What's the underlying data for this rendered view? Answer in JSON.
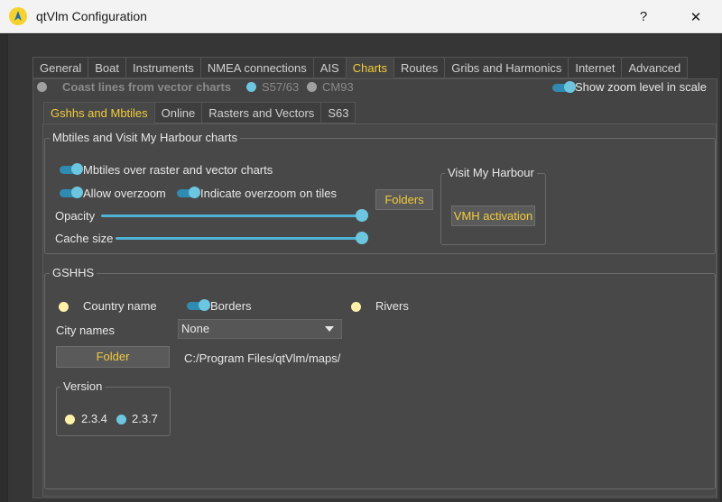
{
  "window": {
    "title": "qtVlm Configuration",
    "help_label": "?",
    "close_label": "✕"
  },
  "main_tabs": [
    {
      "label": "General",
      "active": false
    },
    {
      "label": "Boat",
      "active": false
    },
    {
      "label": "Instruments",
      "active": false
    },
    {
      "label": "NMEA connections",
      "active": false
    },
    {
      "label": "AIS",
      "active": false
    },
    {
      "label": "Charts",
      "active": true
    },
    {
      "label": "Routes",
      "active": false
    },
    {
      "label": "Gribs and Harmonics",
      "active": false
    },
    {
      "label": "Internet",
      "active": false
    },
    {
      "label": "Advanced",
      "active": false
    }
  ],
  "charts_page": {
    "coast_lines_label": "Coast lines from vector charts",
    "s5763_label": "S57/63",
    "cm93_label": "CM93",
    "zoom_level_label": "Show zoom level in scale",
    "sub_tabs": [
      {
        "label": "Gshhs and Mbtiles",
        "active": true
      },
      {
        "label": "Online",
        "active": false
      },
      {
        "label": "Rasters and Vectors",
        "active": false
      },
      {
        "label": "S63",
        "active": false
      }
    ]
  },
  "mbtiles": {
    "group_title": "Mbtiles and Visit My Harbour charts",
    "over_raster_label": "Mbtiles over raster and vector charts",
    "allow_overzoom_label": "Allow overzoom",
    "indicate_overzoom_label": "Indicate overzoom on tiles",
    "opacity_label": "Opacity",
    "opacity_value": 1.0,
    "cache_size_label": "Cache size",
    "cache_size_value": 1.0,
    "folders_button": "Folders",
    "vmh_group_title": "Visit My Harbour",
    "vmh_button": "VMH activation"
  },
  "gshhs": {
    "group_title": "GSHHS",
    "country_name_label": "Country name",
    "borders_label": "Borders",
    "rivers_label": "Rivers",
    "city_names_label": "City names",
    "city_names_value": "None",
    "folder_button": "Folder",
    "folder_path": "C:/Program Files/qtVlm/maps/",
    "version_group_title": "Version",
    "version_options": [
      "2.3.4",
      "2.3.7"
    ],
    "version_selected": "2.3.7"
  },
  "colors": {
    "accent": "#f3cc3a",
    "toggle": "#6cc6e0",
    "background": "#444444"
  }
}
